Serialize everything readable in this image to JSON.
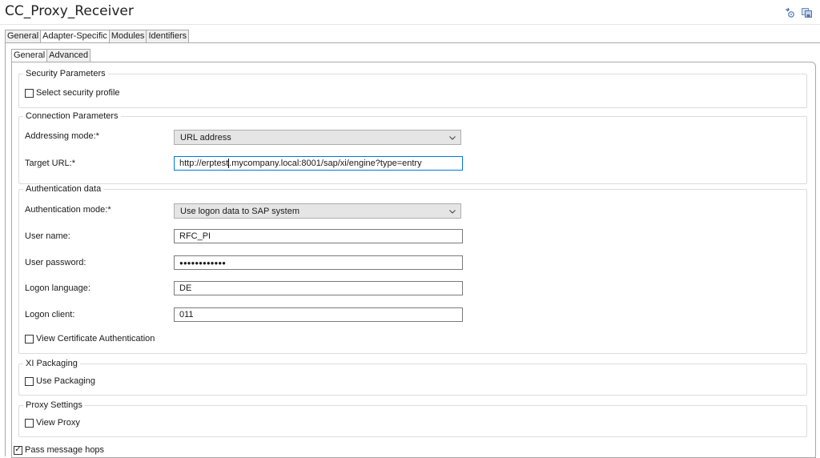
{
  "window": {
    "title": "CC_Proxy_Receiver"
  },
  "icons": [
    "refresh-settings-icon",
    "save-copy-icon"
  ],
  "tabs": [
    "General",
    "Adapter-Specific",
    "Modules",
    "Identifiers"
  ],
  "subtabs": [
    "General",
    "Advanced"
  ],
  "security": {
    "legend": "Security Parameters",
    "select_profile_label": "Select security profile",
    "select_profile_checked": false
  },
  "connection": {
    "legend": "Connection Parameters",
    "addressing_mode_label": "Addressing mode:*",
    "addressing_mode_value": "URL address",
    "target_url_label": "Target URL:*",
    "target_url_before_caret": "http://erptest",
    "target_url_after_caret": ".mycompany.local:8001/sap/xi/engine?type=entry"
  },
  "auth": {
    "legend": "Authentication data",
    "mode_label": "Authentication mode:*",
    "mode_value": "Use logon data to SAP system",
    "user_name_label": "User name:",
    "user_name_value": "RFC_PI",
    "password_label": "User password:",
    "password_value": "●●●●●●●●●●●●",
    "language_label": "Logon language:",
    "language_value": "DE",
    "client_label": "Logon client:",
    "client_value": "011",
    "view_cert_label": "View Certificate Authentication",
    "view_cert_checked": false
  },
  "packaging": {
    "legend": "XI Packaging",
    "use_packaging_label": "Use Packaging",
    "use_packaging_checked": false
  },
  "proxy": {
    "legend": "Proxy Settings",
    "view_proxy_label": "View Proxy",
    "view_proxy_checked": false
  },
  "hops": {
    "label": "Pass message hops",
    "checked": true,
    "check_glyph": "✓"
  }
}
